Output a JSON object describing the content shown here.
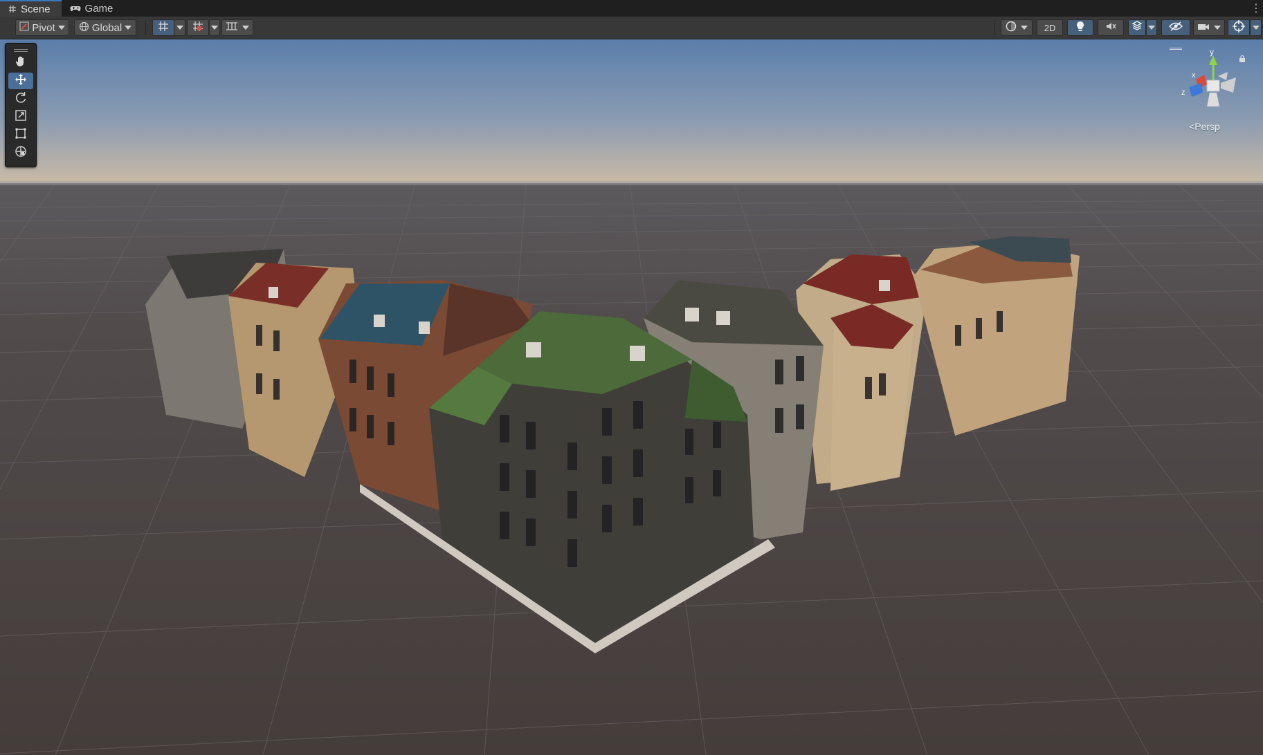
{
  "tabs": [
    {
      "label": "Scene",
      "icon": "grid-icon",
      "active": true
    },
    {
      "label": "Game",
      "icon": "gamepad-icon",
      "active": false
    }
  ],
  "toolbar": {
    "pivot_label": "Pivot",
    "global_label": "Global",
    "mode_2d_label": "2D",
    "icons": [
      "grid-snap-icon",
      "increment-snap-icon",
      "grid-visibility-icon",
      "shading-mode-icon",
      "lighting-toggle-icon",
      "audio-toggle-icon",
      "effects-icon",
      "hidden-objects-icon",
      "camera-settings-icon",
      "gizmos-icon"
    ]
  },
  "tools": [
    "hand-tool",
    "move-tool",
    "rotate-tool",
    "scale-tool",
    "rect-tool",
    "transform-tool"
  ],
  "selected_tool": "move-tool",
  "gizmo": {
    "axis_y": "y",
    "axis_x": "x",
    "axis_z": "z",
    "projection_label": "Persp"
  },
  "colors": {
    "accent": "#4a6f98",
    "sky_top": "#5c7fab",
    "sky_horizon": "#c7b9a6",
    "ground": "#4a4240",
    "axis_x": "#d94a3a",
    "axis_y": "#8fd34a",
    "axis_z": "#3f79d8"
  }
}
